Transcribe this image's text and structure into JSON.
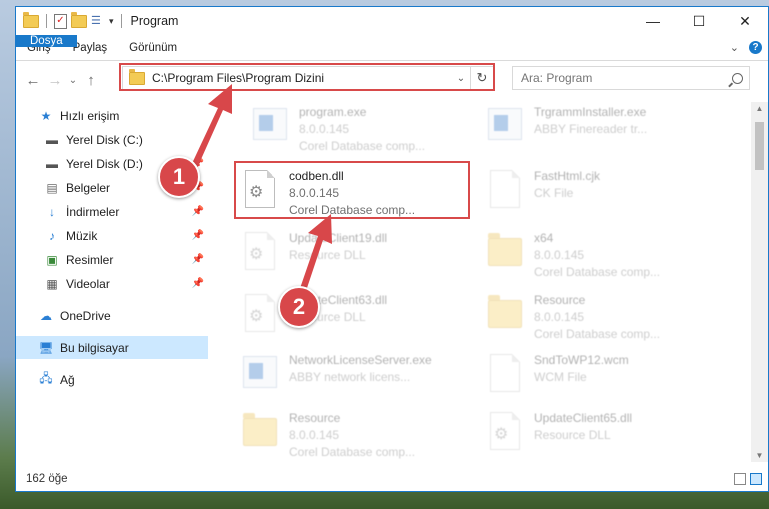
{
  "window": {
    "title": "Program",
    "minimize": "—",
    "maximize": "☐",
    "close": "✕"
  },
  "ribbon": {
    "tabs": [
      "Dosya",
      "Giriş",
      "Paylaş",
      "Görünüm"
    ],
    "expand": "⌄",
    "help": "?"
  },
  "nav": {
    "back": "←",
    "forward": "→",
    "recent": "⌄",
    "up": "↑",
    "address": "C:\\Program Files\\Program Dizini",
    "dropdown": "⌄",
    "refresh": "↻",
    "search_placeholder": "Ara: Program"
  },
  "sidebar": {
    "items": [
      {
        "label": "Hızlı erişim",
        "icon": "star-icon",
        "pinned": false
      },
      {
        "label": "Yerel Disk (C:)",
        "icon": "drive-icon",
        "pinned": false
      },
      {
        "label": "Yerel Disk (D:)",
        "icon": "drive-icon",
        "pinned": true
      },
      {
        "label": "Belgeler",
        "icon": "documents-icon",
        "pinned": true
      },
      {
        "label": "İndirmeler",
        "icon": "download-icon",
        "pinned": true
      },
      {
        "label": "Müzik",
        "icon": "music-icon",
        "pinned": true
      },
      {
        "label": "Resimler",
        "icon": "pictures-icon",
        "pinned": true
      },
      {
        "label": "Videolar",
        "icon": "videos-icon",
        "pinned": true
      },
      {
        "label": "OneDrive",
        "icon": "onedrive-icon",
        "pinned": false
      },
      {
        "label": "Bu bilgisayar",
        "icon": "computer-icon",
        "pinned": false,
        "selected": true
      },
      {
        "label": "Ağ",
        "icon": "network-icon",
        "pinned": false
      }
    ]
  },
  "files": [
    {
      "name": "program.exe",
      "line2": "8.0.0.145",
      "line3": "Corel Database comp...",
      "icon": "app-icon",
      "faded": true
    },
    {
      "name": "TrgrammInstaller.exe",
      "line2": "ABBY Finereader tr...",
      "line3": "",
      "icon": "app-icon",
      "faded": true
    },
    {
      "name": "codben.dll",
      "line2": "8.0.0.145",
      "line3": "Corel Database comp...",
      "icon": "dll-gear-icon",
      "faded": false
    },
    {
      "name": "FastHtml.cjk",
      "line2": "CK File",
      "line3": "",
      "icon": "blank-file-icon",
      "faded": true
    },
    {
      "name": "UpdateClient19.dll",
      "line2": "Resource DLL",
      "line3": "",
      "icon": "dll-gear-icon",
      "faded": true
    },
    {
      "name": "x64",
      "line2": "8.0.0.145",
      "line3": "Corel Database comp...",
      "icon": "folder-icon",
      "faded": true
    },
    {
      "name": "UpdateClient63.dll",
      "line2": "Resource DLL",
      "line3": "",
      "icon": "dll-gear-icon",
      "faded": true
    },
    {
      "name": "Resource",
      "line2": "8.0.0.145",
      "line3": "Corel Database comp...",
      "icon": "folder-icon",
      "faded": true
    },
    {
      "name": "NetworkLicenseServer.exe",
      "line2": "ABBY network licens...",
      "line3": "",
      "icon": "app-icon",
      "faded": true
    },
    {
      "name": "SndToWP12.wcm",
      "line2": "WCM File",
      "line3": "",
      "icon": "blank-file-icon",
      "faded": true
    },
    {
      "name": "Resource",
      "line2": "8.0.0.145",
      "line3": "Corel Database comp...",
      "icon": "folder-icon",
      "faded": true
    },
    {
      "name": "UpdateClient65.dll",
      "line2": "Resource DLL",
      "line3": "",
      "icon": "dll-gear-icon",
      "faded": true
    }
  ],
  "status": {
    "count": "162 öğe"
  },
  "annotations": {
    "step1": "1",
    "step2": "2",
    "highlight_color": "#d84a4a"
  },
  "colors": {
    "accent": "#1979ca",
    "selection": "#cce8ff"
  }
}
